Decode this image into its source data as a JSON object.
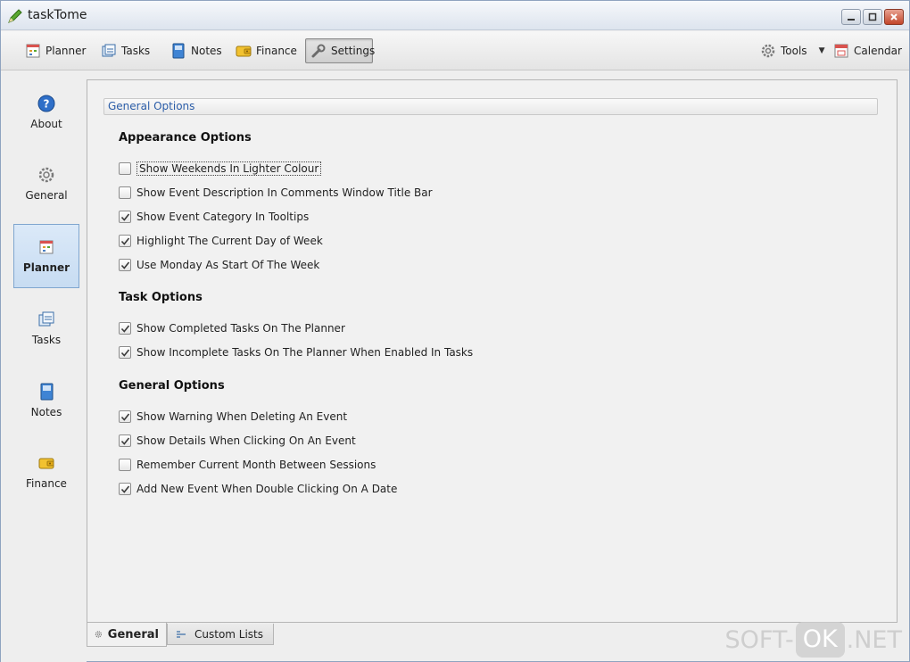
{
  "window": {
    "title": "taskTome"
  },
  "toolbar": {
    "planner": "Planner",
    "tasks": "Tasks",
    "notes": "Notes",
    "finance": "Finance",
    "settings": "Settings",
    "tools": "Tools",
    "calendar": "Calendar"
  },
  "sidebar": {
    "items": [
      {
        "label": "About",
        "icon": "help-icon"
      },
      {
        "label": "General",
        "icon": "gear-icon"
      },
      {
        "label": "Planner",
        "icon": "planner-icon",
        "active": true
      },
      {
        "label": "Tasks",
        "icon": "tasks-icon"
      },
      {
        "label": "Notes",
        "icon": "notes-icon"
      },
      {
        "label": "Finance",
        "icon": "wallet-icon"
      }
    ]
  },
  "content": {
    "header": "General Options",
    "groups": [
      {
        "title": "Appearance Options",
        "options": [
          {
            "label": "Show Weekends In Lighter Colour",
            "checked": false
          },
          {
            "label": "Show Event Description In Comments Window Title Bar",
            "checked": false
          },
          {
            "label": "Show Event Category In Tooltips",
            "checked": true
          },
          {
            "label": "Highlight The Current Day of Week",
            "checked": true
          },
          {
            "label": "Use Monday As Start Of The Week",
            "checked": true
          }
        ]
      },
      {
        "title": "Task Options",
        "options": [
          {
            "label": "Show Completed Tasks On The Planner",
            "checked": true
          },
          {
            "label": "Show Incomplete Tasks On The Planner When Enabled In Tasks",
            "checked": true
          }
        ]
      },
      {
        "title": "General Options",
        "options": [
          {
            "label": "Show Warning When Deleting An Event",
            "checked": true
          },
          {
            "label": "Show Details When Clicking On An Event",
            "checked": true
          },
          {
            "label": "Remember Current Month Between Sessions",
            "checked": false
          },
          {
            "label": "Add New Event When Double Clicking On A Date",
            "checked": true
          }
        ]
      }
    ]
  },
  "tabs": {
    "general": "General",
    "custom_lists": "Custom Lists"
  },
  "watermark": {
    "left": "SOFT-",
    "box": "OK",
    "right": ".NET"
  },
  "colors": {
    "accent": "#2b5da8",
    "active_bg": "#c7dcf2",
    "close_button": "#c2462a"
  }
}
